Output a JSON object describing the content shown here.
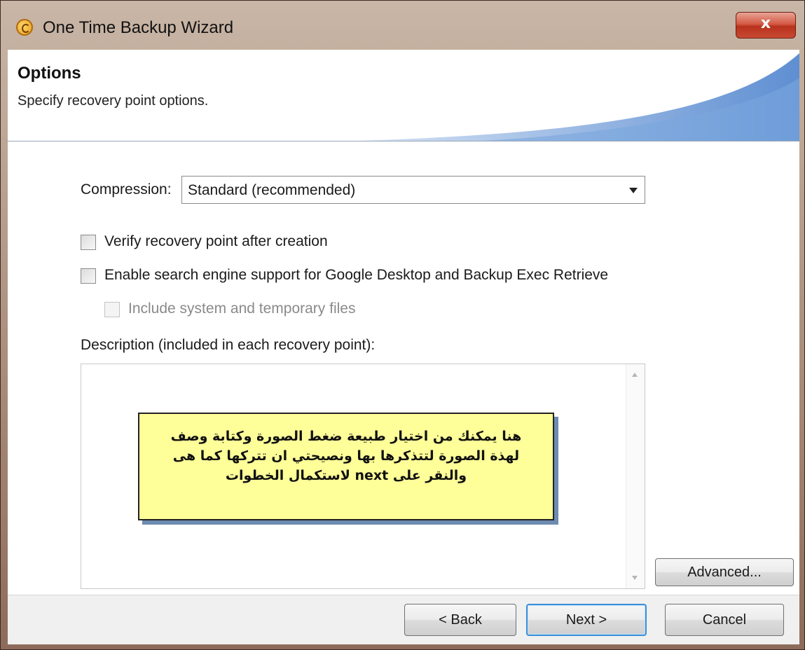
{
  "window": {
    "title": "One Time Backup Wizard",
    "close_label": "x"
  },
  "header": {
    "title": "Options",
    "subtitle": "Specify recovery point options."
  },
  "form": {
    "compression_label": "Compression:",
    "compression_value": "Standard (recommended)",
    "verify_label": "Verify recovery point after creation",
    "verify_checked": false,
    "search_label": "Enable search engine support for Google Desktop and Backup Exec Retrieve",
    "search_checked": false,
    "include_label": "Include system and temporary files",
    "include_checked": false,
    "include_enabled": false,
    "description_label": "Description (included in each recovery point):",
    "description_value": ""
  },
  "buttons": {
    "advanced": "Advanced...",
    "back": "< Back",
    "next": "Next >",
    "cancel": "Cancel"
  },
  "callout": {
    "line1": "هنا يمكنك من اختيار طبيعة ضغط الصورة وكتابة وصف",
    "line2": "لهذة الصورة لتتذكرها بها ونصيحتي ان تتركها كما هى",
    "line3": "والنقر على next لاستكمال الخطوات"
  },
  "colors": {
    "header_accent": "#6f9bd8",
    "callout_bg": "#ffff99",
    "close_red": "#c94a34",
    "default_button_border": "#3c8fd6"
  }
}
